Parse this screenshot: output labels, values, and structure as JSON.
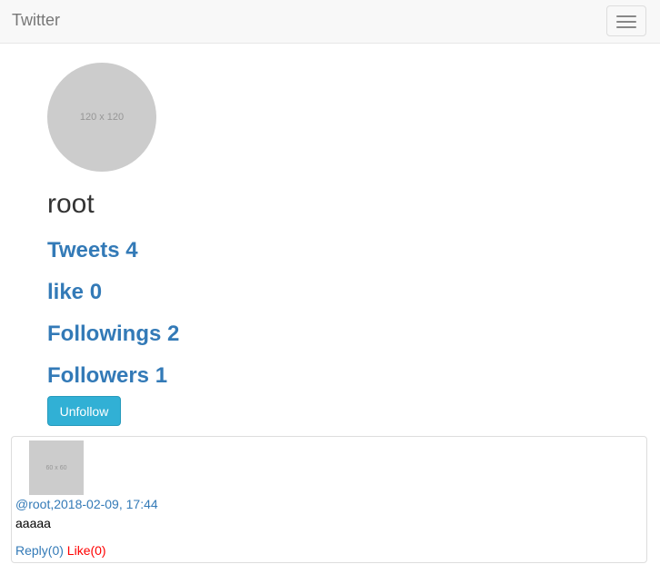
{
  "navbar": {
    "brand": "Twitter",
    "toggle_icon": "hamburger-icon"
  },
  "profile": {
    "avatar_placeholder": "120 x 120",
    "username": "root",
    "stats": {
      "tweets": "Tweets 4",
      "likes": "like 0",
      "followings": "Followings 2",
      "followers": "Followers 1"
    },
    "unfollow_label": "Unfollow"
  },
  "tweets": [
    {
      "thumb_placeholder": "60 x 60",
      "author": "@root",
      "separator": ",",
      "timestamp": "2018-02-09, 17:44",
      "content": "aaaaa",
      "reply_label": "Reply(0)",
      "like_label": "Like(0)"
    }
  ],
  "colors": {
    "link": "#337ab7",
    "like": "#ff0000",
    "button_info": "#31b0d5",
    "navbar_bg": "#f8f8f8",
    "placeholder_bg": "#cccccc"
  }
}
